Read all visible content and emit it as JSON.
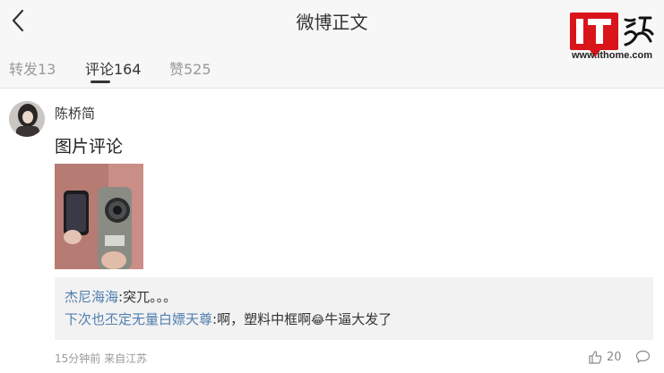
{
  "header": {
    "title": "微博正文",
    "back_icon": "chevron-left-icon"
  },
  "watermark": {
    "logo_text": "IT之家",
    "url": "www.ithome.com"
  },
  "tabs": [
    {
      "label": "转发13",
      "active": false
    },
    {
      "label": "评论164",
      "active": true
    },
    {
      "label": "赞525",
      "active": false
    }
  ],
  "comment": {
    "username": "陈桥简",
    "text": "图片评论",
    "time_location": "15分钟前 来自江苏",
    "likes": "20",
    "replies": [
      {
        "author": "杰尼海海",
        "sep": ":",
        "text": "突兀。。。"
      },
      {
        "author": "下次也丕定无量白嫖天尊",
        "sep": ":",
        "text_before": "啊，塑料中框啊",
        "emoji": "😂",
        "text_after": "牛逼大发了"
      }
    ]
  },
  "colors": {
    "link": "#507daf",
    "logo_red": "#d9151b"
  }
}
